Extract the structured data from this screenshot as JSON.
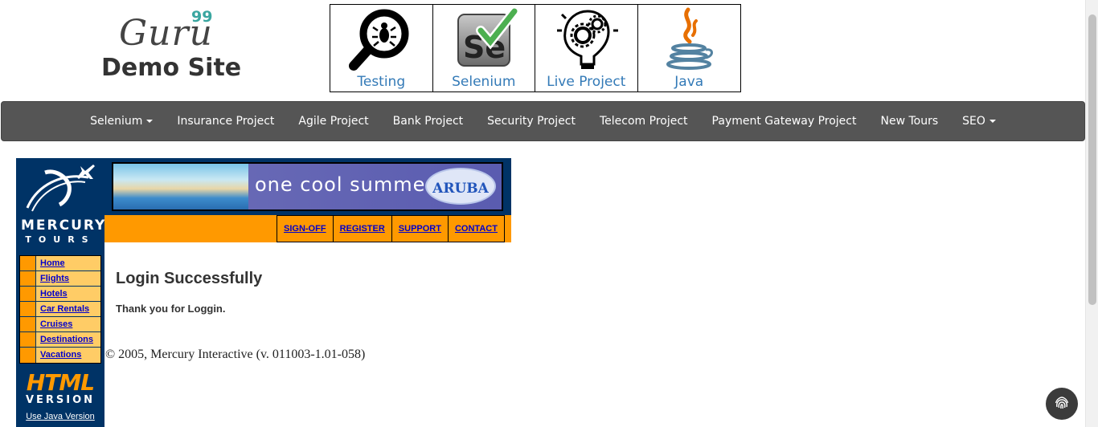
{
  "header": {
    "logo_guru": "Guru",
    "logo_99": "99",
    "logo_subtitle": "Demo Site"
  },
  "tiles": [
    {
      "label": "Testing",
      "icon": "magnifier-bug-icon"
    },
    {
      "label": "Selenium",
      "icon": "selenium-check-icon"
    },
    {
      "label": "Live Project",
      "icon": "lightbulb-gears-icon"
    },
    {
      "label": "Java",
      "icon": "java-cup-icon"
    }
  ],
  "nav": {
    "items": [
      "Selenium",
      "Insurance Project",
      "Agile Project",
      "Bank Project",
      "Security Project",
      "Telecom Project",
      "Payment Gateway Project",
      "New Tours",
      "SEO"
    ]
  },
  "mercury": {
    "logo_word1": "MERCURY",
    "logo_word2": "TOURS",
    "menu": [
      "Home",
      "Flights",
      "Hotels",
      "Car Rentals",
      "Cruises",
      "Destinations",
      "Vacations"
    ],
    "html_word": "HTML",
    "version_word": "VERSION",
    "java_link": "Use Java Version",
    "banner_text": "one cool summer",
    "banner_brand": "ARUBA",
    "top_links": [
      "SIGN-OFF",
      "REGISTER",
      "SUPPORT",
      "CONTACT"
    ],
    "title": "Login Successfully",
    "message": "Thank you for Loggin.",
    "copyright": "© 2005, Mercury Interactive (v. 011003-1.01-058)"
  },
  "colors": {
    "navbar": "#555555",
    "link_blue": "#337ab7",
    "mercury_navy": "#003366",
    "mercury_orange": "#ff9900",
    "menu_yellow": "#ffcc66"
  }
}
